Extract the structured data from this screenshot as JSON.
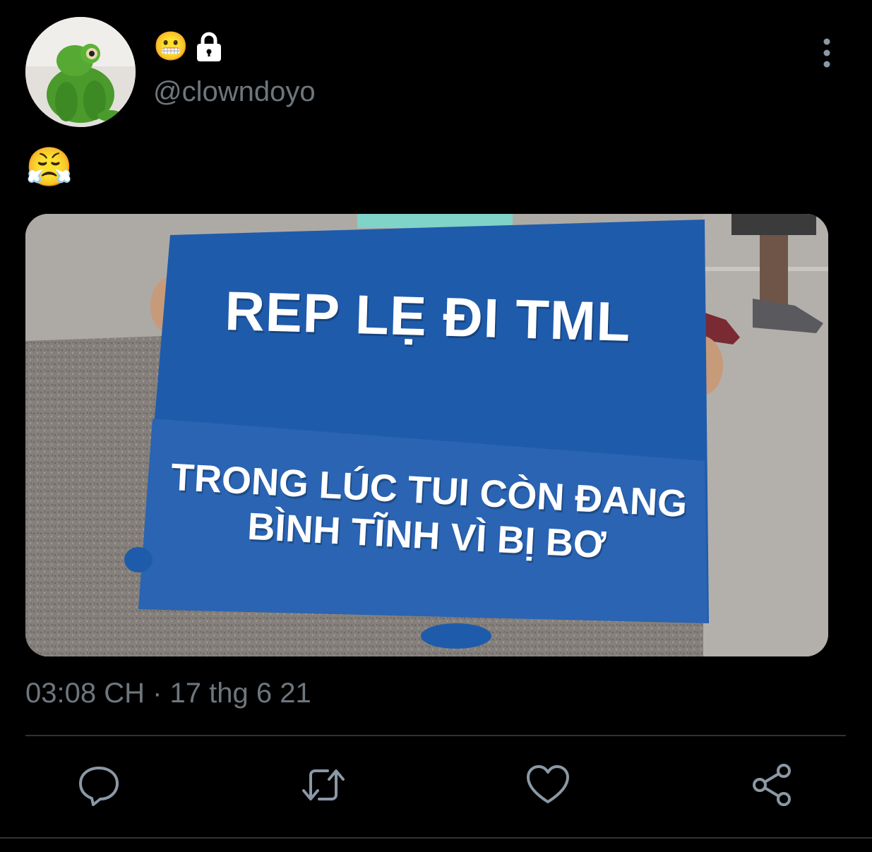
{
  "author": {
    "display_name_emoji": "😬",
    "handle": "@clowndoyo",
    "avatar_icon": "kermit-plush-avatar",
    "locked_icon": "lock-icon"
  },
  "tweet": {
    "text": "😤",
    "image_text_line1": "REP LẸ ĐI TML",
    "image_text_line2a": "TRONG LÚC TUI CÒN ĐANG",
    "image_text_line2b": "BÌNH TĨNH VÌ BỊ BƠ",
    "timestamp": "03:08 CH · 17 thg 6 21"
  },
  "actions": {
    "reply_icon": "reply-icon",
    "retweet_icon": "retweet-icon",
    "like_icon": "heart-icon",
    "share_icon": "share-icon"
  },
  "colors": {
    "background": "#000000",
    "secondary_text": "#6e767d",
    "sign_blue": "#1f5bab"
  }
}
